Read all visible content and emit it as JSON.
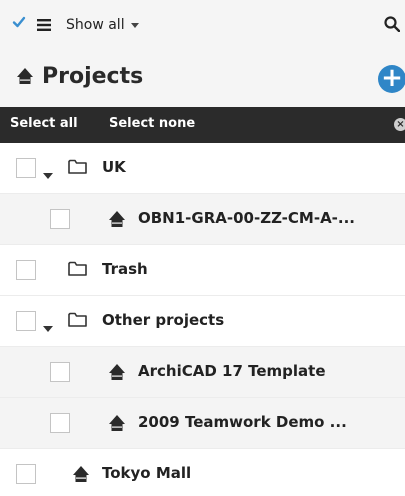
{
  "toolbar": {
    "check_icon": "checkmark-icon",
    "menu_icon": "list-menu-icon",
    "show_filter_label": "Show all",
    "search_icon": "search-icon"
  },
  "header": {
    "title": "Projects",
    "add_icon": "plus-circle-icon",
    "accent_color": "#2f86c7"
  },
  "selection_bar": {
    "select_all_label": "Select all",
    "select_none_label": "Select none",
    "clear_icon": "close-circle-icon"
  },
  "tree": [
    {
      "label": "UK",
      "type": "folder",
      "expanded": true,
      "level": 0
    },
    {
      "label": "OBN1-GRA-00-ZZ-CM-A-...",
      "type": "project",
      "level": 1
    },
    {
      "label": "Trash",
      "type": "folder",
      "expanded": false,
      "level": 0
    },
    {
      "label": "Other projects",
      "type": "folder",
      "expanded": true,
      "level": 0
    },
    {
      "label": "ArchiCAD 17 Template",
      "type": "project",
      "level": 1
    },
    {
      "label": "2009 Teamwork Demo ...",
      "type": "project",
      "level": 1
    },
    {
      "label": "Tokyo Mall",
      "type": "project",
      "level": 0
    }
  ]
}
